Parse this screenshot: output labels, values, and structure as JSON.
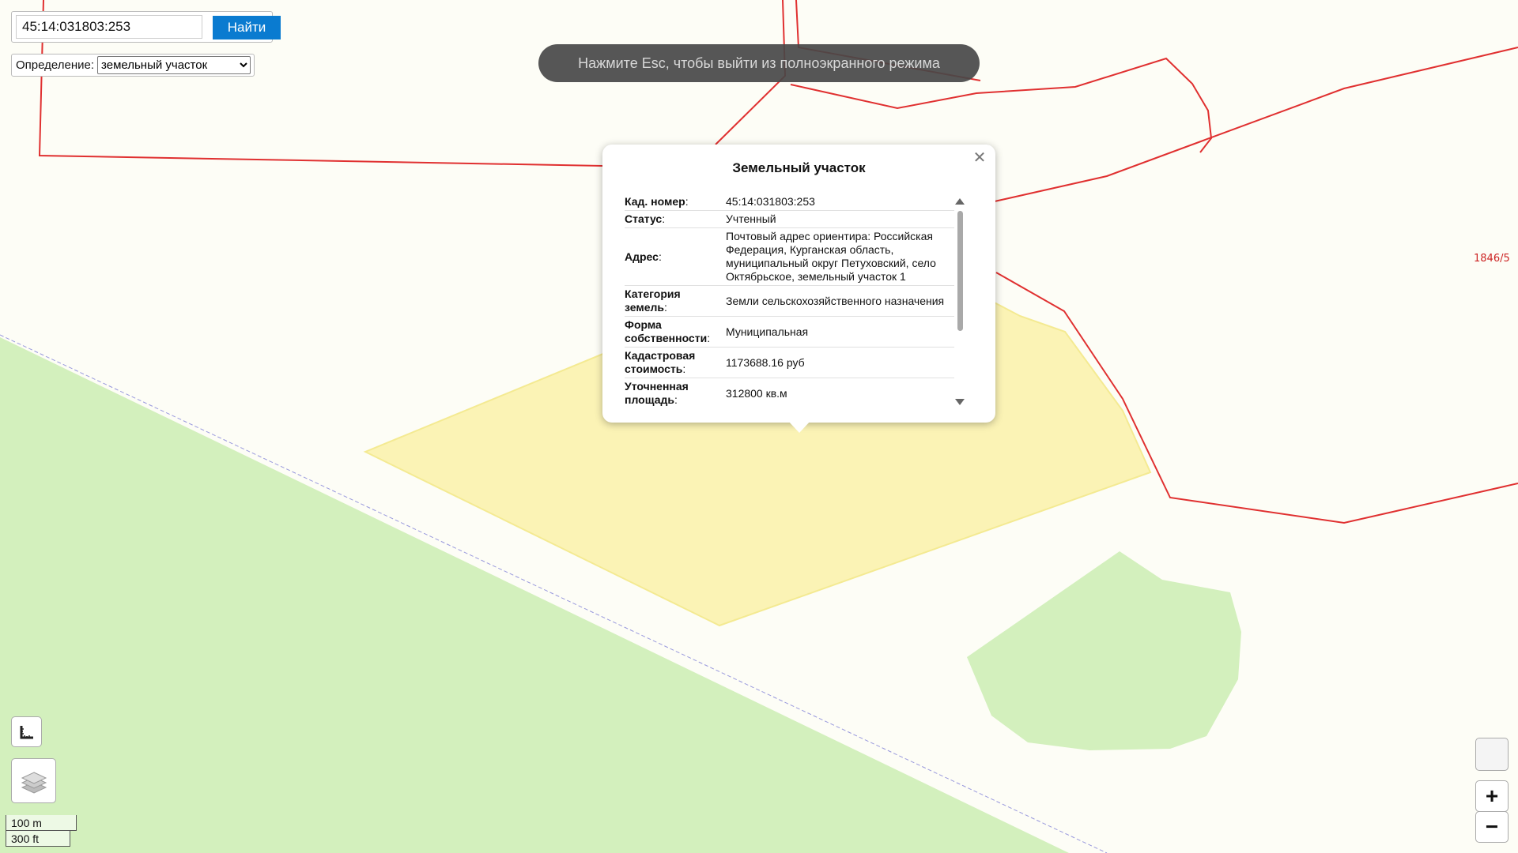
{
  "search": {
    "value": "45:14:031803:253",
    "button_label": "Найти"
  },
  "definition": {
    "label": "Определение:",
    "selected": "земельный участок"
  },
  "fullscreen_notice": "Нажмите Esc, чтобы выйти из полноэкранного режима",
  "popup": {
    "title": "Земельный участок",
    "rows": [
      {
        "key": "Кад. номер",
        "value": "45:14:031803:253"
      },
      {
        "key": "Статус",
        "value": "Учтенный"
      },
      {
        "key": "Адрес",
        "value": "Почтовый адрес ориентира: Российская Федерация, Курганская область, муниципальный округ Петуховский, село Октябрьское, земельный участок 1"
      },
      {
        "key": "Категория земель",
        "value": "Земли сельскохозяйственного назначения"
      },
      {
        "key": "Форма собственности",
        "value": "Муниципальная"
      },
      {
        "key": "Кадастровая стоимость",
        "value": "1173688.16 руб"
      },
      {
        "key": "Уточненная площадь",
        "value": "312800 кв.м"
      }
    ],
    "close_icon": "close-icon"
  },
  "map": {
    "parcel_label": "1846/5",
    "colors": {
      "background": "#fdfdf6",
      "forest": "#d3f0bd",
      "selected_parcel": "#fbf3b5",
      "parcel_border": "#e03030"
    }
  },
  "scale": {
    "metric": "100 m",
    "imperial": "300 ft"
  },
  "controls": {
    "zoom_in": "+",
    "zoom_out": "−",
    "ruler_icon": "ruler-icon",
    "layers_icon": "layers-icon"
  }
}
